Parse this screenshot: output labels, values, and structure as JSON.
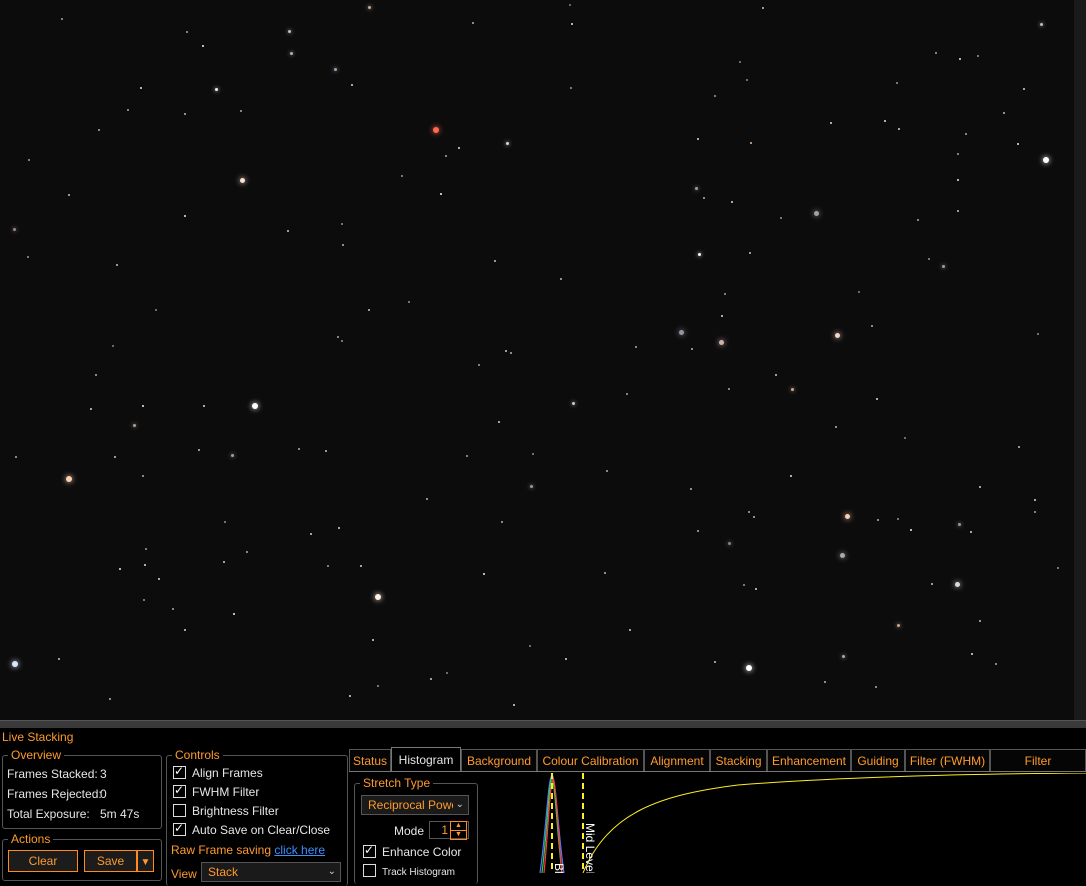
{
  "panel": {
    "title": "Live Stacking"
  },
  "overview": {
    "title": "Overview",
    "rows": [
      {
        "label": "Frames Stacked:",
        "value": "3"
      },
      {
        "label": "Frames Rejected:",
        "value": "0"
      },
      {
        "label": "Total Exposure:",
        "value": "5m 47s"
      }
    ]
  },
  "actions": {
    "title": "Actions",
    "clear_label": "Clear",
    "save_label": "Save",
    "save_menu_icon": "caret-down-icon"
  },
  "controls": {
    "title": "Controls",
    "checkboxes": [
      {
        "label": "Align Frames",
        "checked": true
      },
      {
        "label": "FWHM Filter",
        "checked": true
      },
      {
        "label": "Brightness Filter",
        "checked": false
      },
      {
        "label": "Auto Save on Clear/Close",
        "checked": true
      }
    ],
    "raw_frame_label": "Raw Frame saving",
    "raw_frame_link": "click here",
    "view_label": "View",
    "view_value": "Stack"
  },
  "tabs": [
    {
      "label": "Status",
      "active": false
    },
    {
      "label": "Histogram",
      "active": true
    },
    {
      "label": "Background",
      "active": false
    },
    {
      "label": "Colour Calibration",
      "active": false
    },
    {
      "label": "Alignment",
      "active": false
    },
    {
      "label": "Stacking",
      "active": false
    },
    {
      "label": "Enhancement",
      "active": false
    },
    {
      "label": "Guiding",
      "active": false
    },
    {
      "label": "Filter (FWHM)",
      "active": false
    },
    {
      "label": "Filter (Brightness)",
      "active": false
    }
  ],
  "stretch": {
    "title": "Stretch Type",
    "type_value": "Reciprocal Powe",
    "mode_label": "Mode",
    "mode_value": "1",
    "enhance_color_label": "Enhance Color",
    "enhance_color_checked": true,
    "track_histogram_label": "Track Histogram",
    "track_histogram_checked": false
  },
  "histogram": {
    "mid_level_label": "Mid Level",
    "black_level_label": "Bl",
    "colors": {
      "curve": "#ffee22",
      "red": "#ff3a3a",
      "green": "#3ad04a",
      "blue": "#4a7aff",
      "marker": "#ffee22"
    }
  },
  "colors": {
    "accent": "#ff9a2e",
    "link": "#3b8fff",
    "sky": "#0d0c0d"
  }
}
